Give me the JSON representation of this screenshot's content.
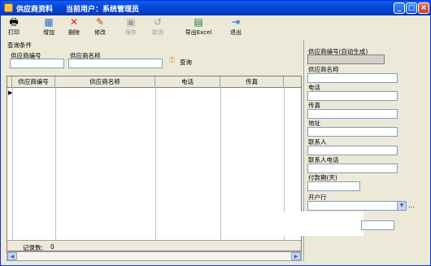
{
  "window": {
    "title": "供应商资料",
    "current_user": "当前用户：系统管理员",
    "controls": {
      "minimize": "_",
      "maximize": "□",
      "close": "×"
    }
  },
  "toolbar": [
    {
      "id": "print",
      "label": "打印",
      "icon": "printer-icon",
      "glyph": "🖶",
      "enabled": true
    },
    {
      "id": "add",
      "label": "增加",
      "icon": "add-icon",
      "glyph": "▦",
      "enabled": true
    },
    {
      "id": "delete",
      "label": "删除",
      "icon": "delete-icon",
      "glyph": "✕",
      "enabled": true
    },
    {
      "id": "edit",
      "label": "修改",
      "icon": "edit-icon",
      "glyph": "✎",
      "enabled": true
    },
    {
      "id": "save",
      "label": "保存",
      "icon": "save-icon",
      "glyph": "▣",
      "enabled": false
    },
    {
      "id": "cancel",
      "label": "取消",
      "icon": "cancel-icon",
      "glyph": "↺",
      "enabled": false
    },
    {
      "id": "export",
      "label": "导出Excel",
      "icon": "export-excel-icon",
      "glyph": "▤",
      "enabled": true
    },
    {
      "id": "exit",
      "label": "退出",
      "icon": "exit-icon",
      "glyph": "⇥",
      "enabled": true
    }
  ],
  "query": {
    "section_label": "查询条件",
    "supplier_code_label": "供应商编号",
    "supplier_code_value": "",
    "supplier_name_label": "供应商名称",
    "supplier_name_value": "",
    "search_label": "查询"
  },
  "grid": {
    "columns": [
      "供应商编号",
      "供应商名称",
      "电话",
      "传真"
    ],
    "row_indicator": "▶",
    "footer_label": "记录数:",
    "record_count": "0"
  },
  "detail": {
    "fields": [
      {
        "label": "供应商编号(自动生成)",
        "value": "",
        "readonly": true
      },
      {
        "label": "供应商名称",
        "value": ""
      },
      {
        "label": "电话",
        "value": ""
      },
      {
        "label": "传真",
        "value": ""
      },
      {
        "label": "地址",
        "value": ""
      },
      {
        "label": "联系人",
        "value": ""
      },
      {
        "label": "联系人电话",
        "value": ""
      },
      {
        "label": "付款期(天)",
        "value": ""
      }
    ],
    "bank_label": "开户行",
    "bank_value": "",
    "bank_more": "…"
  },
  "colors": {
    "titlebar": "#0A4FE0",
    "window_bg": "#ECE9D8",
    "input_border": "#7F9DB9"
  }
}
